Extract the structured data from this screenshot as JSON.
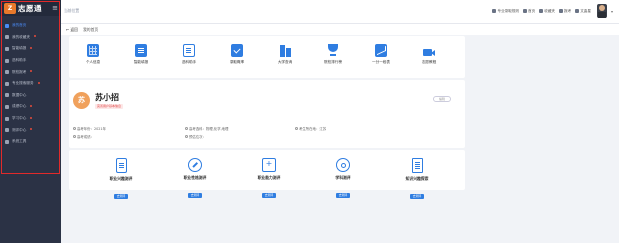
{
  "brand": {
    "logo_text": "志愿通",
    "menu_icon": "menu-icon"
  },
  "breadcrumb": "当前位置",
  "top_actions": [
    {
      "label": "专业录取规则",
      "icon": "doc-icon"
    },
    {
      "label": "首页",
      "icon": "home-icon"
    },
    {
      "label": "收藏夹",
      "icon": "star-icon"
    },
    {
      "label": "报考",
      "icon": "form-icon"
    },
    {
      "label": "文曲星",
      "icon": "grid-icon"
    }
  ],
  "tabs": {
    "back": "← 返回",
    "current": "我的首页"
  },
  "sidebar": {
    "items": [
      {
        "label": "我的首页",
        "active": true
      },
      {
        "label": "我的收藏夹",
        "active": false,
        "dot": true
      },
      {
        "label": "智能填报",
        "active": false,
        "dot": true
      },
      {
        "label": "选科助手",
        "active": false
      },
      {
        "label": "院校报考",
        "active": false,
        "dot": true
      },
      {
        "label": "专业搜索服务",
        "active": false,
        "dot": true
      },
      {
        "label": "数据中心",
        "active": false
      },
      {
        "label": "成绩中心",
        "active": false,
        "dot": true
      },
      {
        "label": "学习中心",
        "active": false,
        "dot": true
      },
      {
        "label": "测评中心",
        "active": false,
        "dot": true
      },
      {
        "label": "系统工具",
        "active": false
      }
    ]
  },
  "quick_links": [
    {
      "label": "个人信息",
      "icon": "grid-icon"
    },
    {
      "label": "智能填报",
      "icon": "document-icon"
    },
    {
      "label": "选科助手",
      "icon": "notebook-icon"
    },
    {
      "label": "录取概率",
      "icon": "checkbox-icon"
    },
    {
      "label": "大学查询",
      "icon": "building-icon"
    },
    {
      "label": "院校排行榜",
      "icon": "trophy-icon"
    },
    {
      "label": "一分一段表",
      "icon": "line-chart-icon"
    },
    {
      "label": "志愿教程",
      "icon": "video-camera-icon"
    }
  ],
  "profile": {
    "avatar_char": "苏",
    "name": "苏小招",
    "tag": "完善用户基本信息",
    "edit_label": "编辑",
    "info": [
      "高考年份：2021年",
      "高考选科：物理,化学,地理",
      "考生所在地：江苏",
      "高考成绩：",
      "预估位次："
    ]
  },
  "assessments": [
    {
      "title": "职业兴趣测评",
      "button": "去测评",
      "icon": "clipboard-icon"
    },
    {
      "title": "职业性格测评",
      "button": "去测评",
      "icon": "compass-icon"
    },
    {
      "title": "职业能力测评",
      "button": "去测评",
      "icon": "plus-box-icon"
    },
    {
      "title": "学科测评",
      "button": "去测评",
      "icon": "target-icon"
    },
    {
      "title": "知识兴趣探索",
      "button": "去测评",
      "icon": "list-doc-icon"
    }
  ],
  "colors": {
    "accent": "#2f7de1",
    "sidebar_bg": "#2b3245",
    "highlight": "#e12a2a"
  }
}
